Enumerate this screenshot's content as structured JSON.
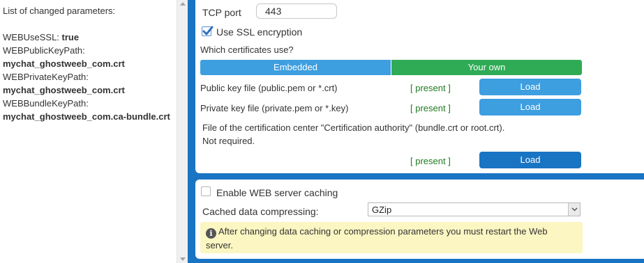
{
  "left_panel": {
    "header": "List of changed parameters:",
    "params": [
      {
        "name": "WEBUseSSL:",
        "value": "true",
        "inline": true
      },
      {
        "name": "WEBPublicKeyPath:",
        "value": "mychat_ghostweeb_com.crt",
        "inline": false
      },
      {
        "name": "WEBPrivateKeyPath:",
        "value": "mychat_ghostweeb_com.crt",
        "inline": false
      },
      {
        "name": "WEBBundleKeyPath:",
        "value": "mychat_ghostweeb_com.ca-bundle.crt",
        "inline": false
      }
    ]
  },
  "ssl": {
    "tcp_port_label": "TCP port",
    "tcp_port_value": "443",
    "use_ssl_label": "Use SSL encryption",
    "use_ssl_checked": true,
    "which_certs_label": "Which certificates use?",
    "segments": [
      {
        "label": "Embedded",
        "color": "#3d9ee0",
        "selected": false
      },
      {
        "label": "Your own",
        "color": "#2fab55",
        "selected": true
      }
    ],
    "public_key_label": "Public key file (public.pem or *.crt)",
    "public_key_status": "[ present ]",
    "private_key_label": "Private key file (private.pem or *.key)",
    "private_key_status": "[ present ]",
    "ca_label_line1": "File of the certification center \"Certification authority\" (bundle.crt or root.crt).",
    "ca_label_line2": "Not required.",
    "ca_status": "[ present ]",
    "load_label": "Load"
  },
  "cache": {
    "enable_label": "Enable WEB server caching",
    "enable_checked": false,
    "compress_label": "Cached data compressing:",
    "compress_value": "GZip",
    "notice_icon": "info-icon",
    "notice_text": "After changing data caching or compression parameters you must restart the Web server."
  },
  "colors": {
    "accent_blue": "#1a74c4",
    "button_blue": "#3d9ee0",
    "green": "#2fab55",
    "present_green": "#1f7a1f",
    "notice_bg": "#fbf6c2"
  }
}
